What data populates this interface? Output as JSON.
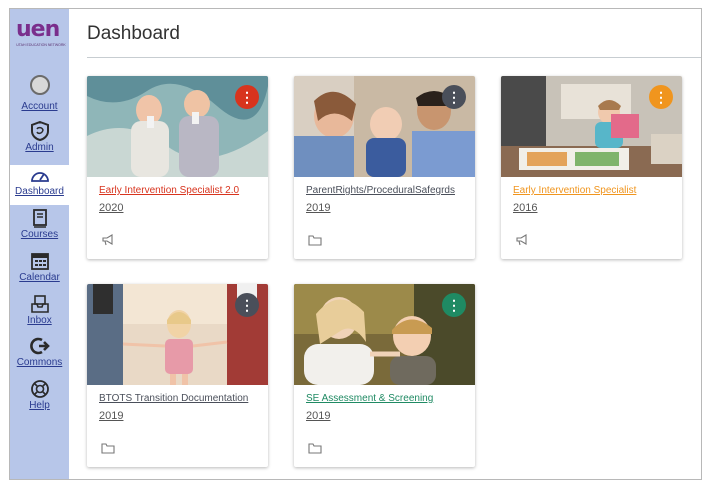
{
  "logo": {
    "text": "uen",
    "subtitle": "UTAH EDUCATION NETWORK"
  },
  "nav": [
    {
      "label": "Account",
      "icon": "account-avatar-icon"
    },
    {
      "label": "Admin",
      "icon": "shield-icon"
    },
    {
      "label": "Dashboard",
      "icon": "speedometer-icon",
      "active": true
    },
    {
      "label": "Courses",
      "icon": "book-icon"
    },
    {
      "label": "Calendar",
      "icon": "calendar-icon"
    },
    {
      "label": "Inbox",
      "icon": "inbox-icon"
    },
    {
      "label": "Commons",
      "icon": "commons-arrow-icon"
    },
    {
      "label": "Help",
      "icon": "lifebuoy-icon"
    }
  ],
  "header": {
    "title": "Dashboard"
  },
  "cards": [
    {
      "name": "Early Intervention Specialist 2.0",
      "term": "2020",
      "color": "#d8341e",
      "action_icon": "announcement-icon"
    },
    {
      "name": "ParentRights/ProceduralSafegrds",
      "term": "2019",
      "color": "#4a4f5a",
      "action_icon": "folder-icon"
    },
    {
      "name": "Early Intervention Specialist",
      "term": "2016",
      "color": "#f0951e",
      "action_icon": "announcement-icon"
    },
    {
      "name": "BTOTS Transition Documentation",
      "term": "2019",
      "color": "#4a4f5a",
      "action_icon": "folder-icon"
    },
    {
      "name": "SE Assessment & Screening",
      "term": "2019",
      "color": "#1f8a63",
      "action_icon": "folder-icon"
    }
  ],
  "card_menu_glyph": "⋮"
}
